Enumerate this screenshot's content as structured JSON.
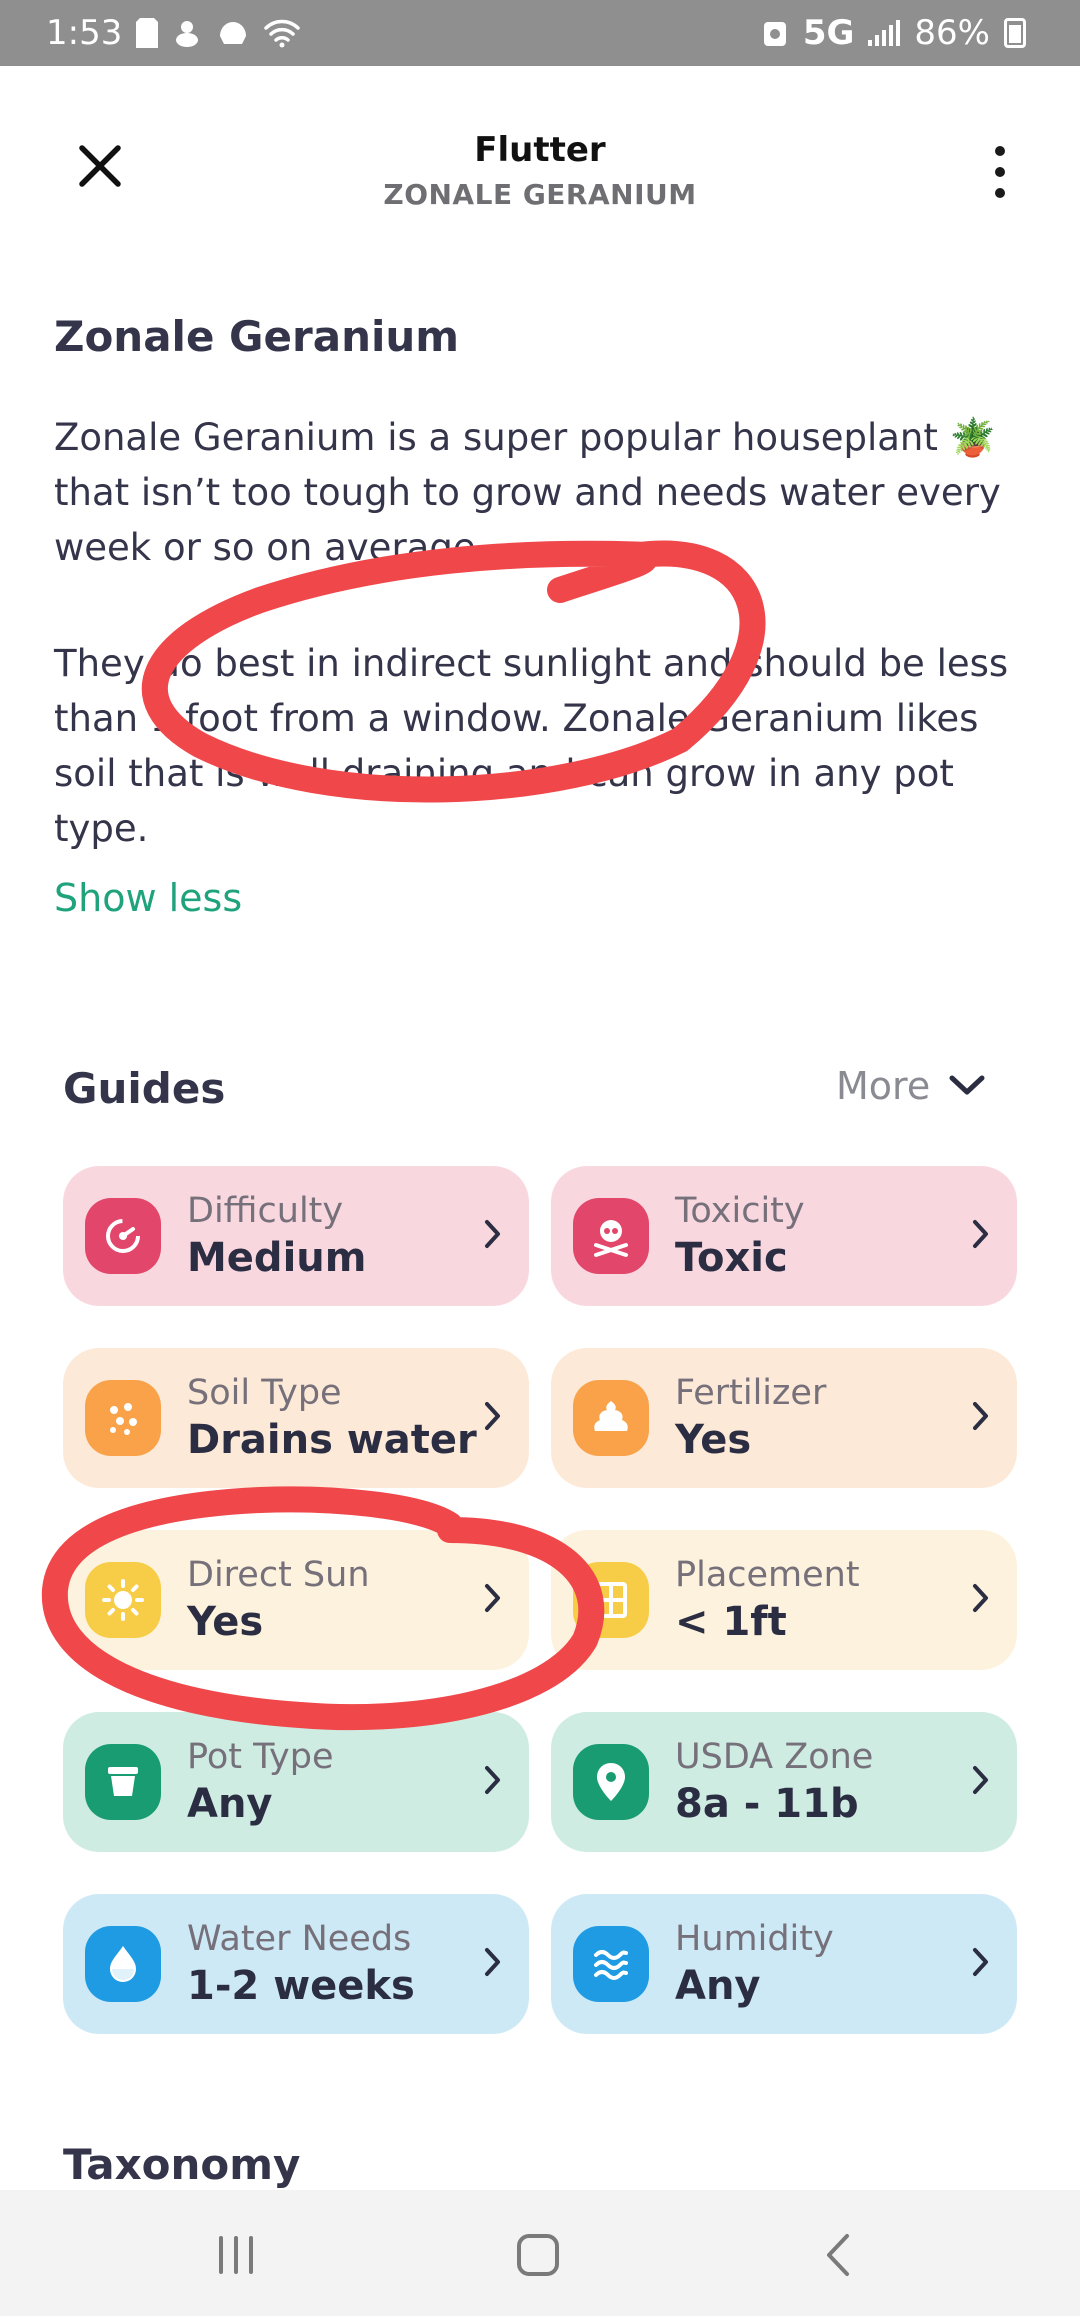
{
  "status_bar": {
    "time": "1:53",
    "network": "5G",
    "battery": "86%"
  },
  "header": {
    "title": "Flutter",
    "subtitle": "ZONALE GERANIUM"
  },
  "plant": {
    "name": "Zonale Geranium",
    "description_1": "Zonale Geranium is a super popular houseplant 🪴 that isn’t too tough to grow and needs water every week or so on average.",
    "description_2": "They do best in indirect sunlight and should be less than 1 foot from a window. Zonale Geranium likes soil that is well draining and can grow in any pot type.",
    "show_less": "Show less"
  },
  "guides": {
    "title": "Guides",
    "more": "More",
    "items": [
      {
        "label": "Difficulty",
        "value": "Medium",
        "icon": "difficulty-icon",
        "color": "#e2466a"
      },
      {
        "label": "Toxicity",
        "value": "Toxic",
        "icon": "skull-icon",
        "color": "#e2466a"
      },
      {
        "label": "Soil Type",
        "value": "Drains water",
        "icon": "soil-icon",
        "color": "#f9a24a"
      },
      {
        "label": "Fertilizer",
        "value": "Yes",
        "icon": "fertilizer-icon",
        "color": "#f9a24a"
      },
      {
        "label": "Direct Sun",
        "value": "Yes",
        "icon": "sun-icon",
        "color": "#f7cd48"
      },
      {
        "label": "Placement",
        "value": "< 1ft",
        "icon": "window-icon",
        "color": "#f7cd48"
      },
      {
        "label": "Pot Type",
        "value": "Any",
        "icon": "pot-icon",
        "color": "#1a9c72"
      },
      {
        "label": "USDA Zone",
        "value": "8a - 11b",
        "icon": "location-pin-icon",
        "color": "#1a9c72"
      },
      {
        "label": "Water Needs",
        "value": "1-2 weeks",
        "icon": "water-drop-icon",
        "color": "#1e9be2"
      },
      {
        "label": "Humidity",
        "value": "Any",
        "icon": "humidity-icon",
        "color": "#1e9be2"
      }
    ]
  },
  "taxonomy": {
    "title": "Taxonomy"
  },
  "annotation_color": "#f0474a"
}
